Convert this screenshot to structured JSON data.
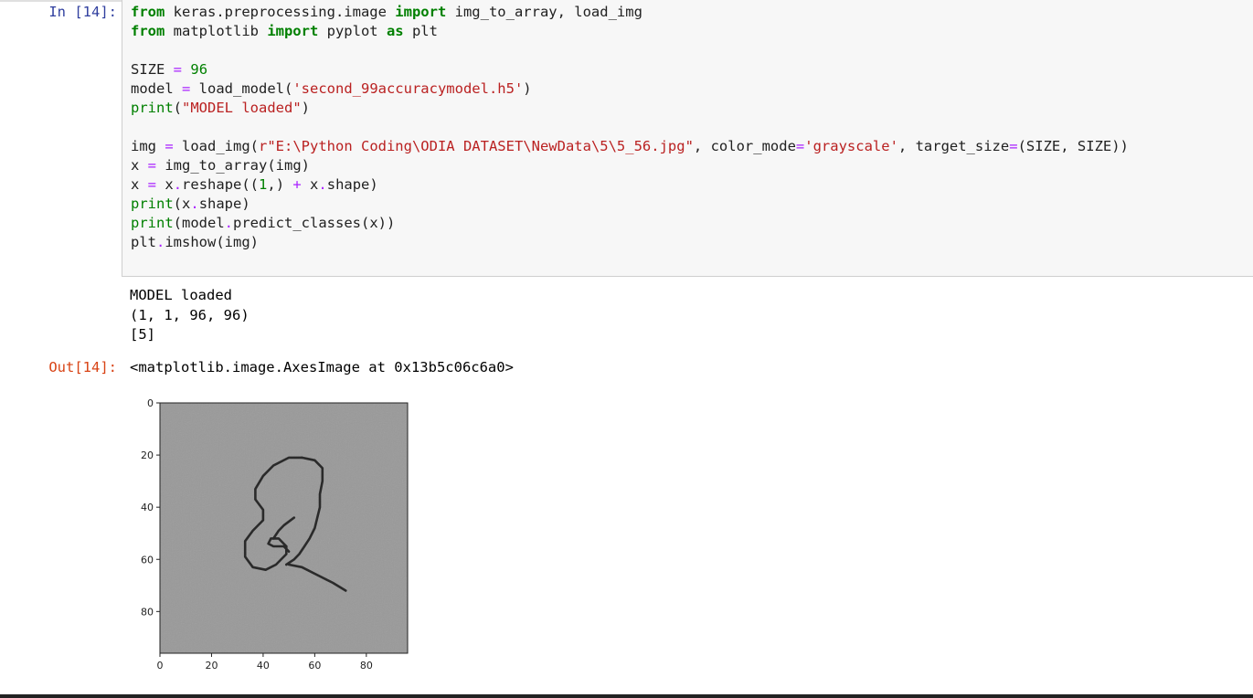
{
  "cell": {
    "in_prompt": "In [14]:",
    "out_prompt": "Out[14]:",
    "code_lines": [
      [
        {
          "t": "from",
          "c": "kw"
        },
        {
          "t": " keras.preprocessing.image ",
          "c": ""
        },
        {
          "t": "import",
          "c": "kw"
        },
        {
          "t": " img_to_array, load_img",
          "c": ""
        }
      ],
      [
        {
          "t": "from",
          "c": "kw"
        },
        {
          "t": " matplotlib ",
          "c": ""
        },
        {
          "t": "import",
          "c": "kw"
        },
        {
          "t": " pyplot ",
          "c": ""
        },
        {
          "t": "as",
          "c": "kw"
        },
        {
          "t": " plt",
          "c": ""
        }
      ],
      [],
      [
        {
          "t": "SIZE ",
          "c": ""
        },
        {
          "t": "=",
          "c": "op"
        },
        {
          "t": " ",
          "c": ""
        },
        {
          "t": "96",
          "c": "num"
        }
      ],
      [
        {
          "t": "model ",
          "c": ""
        },
        {
          "t": "=",
          "c": "op"
        },
        {
          "t": " load_model(",
          "c": ""
        },
        {
          "t": "'second_99accuracymodel.h5'",
          "c": "str"
        },
        {
          "t": ")",
          "c": ""
        }
      ],
      [
        {
          "t": "print",
          "c": "bi"
        },
        {
          "t": "(",
          "c": ""
        },
        {
          "t": "\"MODEL loaded\"",
          "c": "str"
        },
        {
          "t": ")",
          "c": ""
        }
      ],
      [],
      [
        {
          "t": "img ",
          "c": ""
        },
        {
          "t": "=",
          "c": "op"
        },
        {
          "t": " load_img(",
          "c": ""
        },
        {
          "t": "r\"E:\\Python Coding\\ODIA DATASET\\NewData\\5\\5_56.jpg\"",
          "c": "str"
        },
        {
          "t": ", color_mode",
          "c": ""
        },
        {
          "t": "=",
          "c": "op"
        },
        {
          "t": "'grayscale'",
          "c": "str"
        },
        {
          "t": ", target_size",
          "c": ""
        },
        {
          "t": "=",
          "c": "op"
        },
        {
          "t": "(SIZE, SIZE))",
          "c": ""
        }
      ],
      [
        {
          "t": "x ",
          "c": ""
        },
        {
          "t": "=",
          "c": "op"
        },
        {
          "t": " img_to_array(img)",
          "c": ""
        }
      ],
      [
        {
          "t": "x ",
          "c": ""
        },
        {
          "t": "=",
          "c": "op"
        },
        {
          "t": " x",
          "c": ""
        },
        {
          "t": ".",
          "c": "op"
        },
        {
          "t": "reshape((",
          "c": ""
        },
        {
          "t": "1",
          "c": "num"
        },
        {
          "t": ",) ",
          "c": ""
        },
        {
          "t": "+",
          "c": "op"
        },
        {
          "t": " x",
          "c": ""
        },
        {
          "t": ".",
          "c": "op"
        },
        {
          "t": "shape)",
          "c": ""
        }
      ],
      [
        {
          "t": "print",
          "c": "bi"
        },
        {
          "t": "(x",
          "c": ""
        },
        {
          "t": ".",
          "c": "op"
        },
        {
          "t": "shape)",
          "c": ""
        }
      ],
      [
        {
          "t": "print",
          "c": "bi"
        },
        {
          "t": "(model",
          "c": ""
        },
        {
          "t": ".",
          "c": "op"
        },
        {
          "t": "predict_classes(x))",
          "c": ""
        }
      ],
      [
        {
          "t": "plt",
          "c": ""
        },
        {
          "t": ".",
          "c": "op"
        },
        {
          "t": "imshow(img)",
          "c": ""
        }
      ]
    ],
    "stdout_lines": [
      "MODEL loaded",
      "(1, 1, 96, 96)",
      "[5]"
    ],
    "result_repr": "<matplotlib.image.AxesImage at 0x13b5c06c6a0>"
  },
  "chart_data": {
    "type": "image",
    "title": "",
    "xlabel": "",
    "ylabel": "",
    "xlim": [
      0,
      96
    ],
    "ylim": [
      96,
      0
    ],
    "x_ticks": [
      "0",
      "20",
      "40",
      "60",
      "80"
    ],
    "y_ticks": [
      "0",
      "20",
      "40",
      "60",
      "80"
    ],
    "image_content": "grayscale handwritten Odia digit",
    "colors": {
      "background": "#999999",
      "stroke": "#2a2a2a"
    }
  }
}
